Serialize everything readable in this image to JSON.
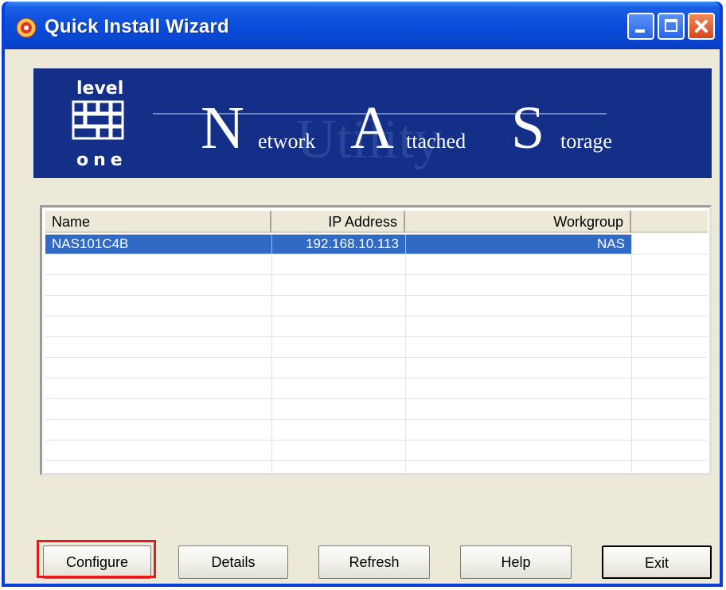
{
  "window": {
    "title": "Quick Install Wizard",
    "accent_color": "#0a3ed8",
    "icon": "nas-disc-icon"
  },
  "banner": {
    "logo_top": "level",
    "logo_bottom": "one",
    "big_n": "N",
    "word1": "etwork",
    "big_a": "A",
    "word2": "ttached",
    "big_s": "S",
    "word3": "torage",
    "watermark": "Utility",
    "background": "#132f87"
  },
  "table": {
    "columns": [
      "Name",
      "IP Address",
      "Workgroup"
    ],
    "rows": [
      {
        "name": "NAS101C4B",
        "ip": "192.168.10.113",
        "workgroup": "NAS",
        "selected": true
      }
    ],
    "selection_color": "#316ac5"
  },
  "buttons": {
    "configure": "Configure",
    "details": "Details",
    "refresh": "Refresh",
    "help": "Help",
    "exit": "Exit"
  },
  "annotation": {
    "highlight_color": "#e21b1b",
    "highlighted": "configure"
  }
}
